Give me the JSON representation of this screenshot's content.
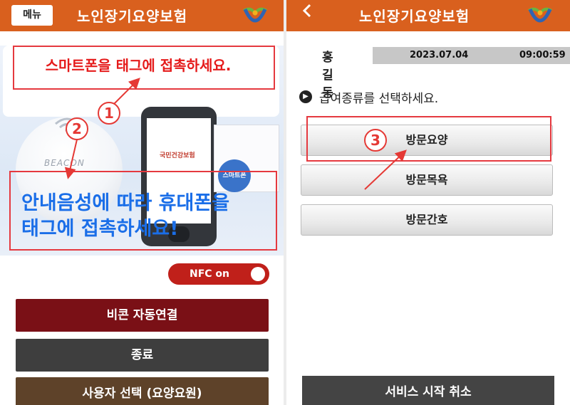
{
  "left_panel": {
    "header": {
      "menu_label": "메뉴",
      "title": "노인장기요양보험",
      "logo": "ltc-insurance-logo"
    },
    "instruction_top": "스마트폰을 태그에 접촉하세요.",
    "instruction_main_line1": "안내음성에 따라 휴대폰을",
    "instruction_main_line2": "태그에 접촉하세요!",
    "beacon_label": "BEACON",
    "phone_screen": {
      "brand": "국민건강보험",
      "circle_text": "스마트폰"
    },
    "badges": [
      "1",
      "2"
    ],
    "nfc_toggle": {
      "label": "NFC on",
      "state": "on"
    },
    "buttons": {
      "beacon_connect": "비콘 자동연결",
      "exit": "종료",
      "select_user": "사용자 선택 (요양요원)"
    }
  },
  "right_panel": {
    "header": {
      "back_icon": "chevron-left-icon",
      "title": "노인장기요양보험",
      "logo": "ltc-insurance-logo"
    },
    "user_name": "홍길동",
    "date": "2023.07.04",
    "time": "09:00:59",
    "prompt": "급여종류를 선택하세요.",
    "badge": "3",
    "services": [
      "방문요양",
      "방문목욕",
      "방문간호"
    ],
    "cancel_label": "서비스 시작 취소"
  },
  "colors": {
    "header": "#d9601e",
    "beacon_button": "#7a1016",
    "exit_button": "#3e3e3e",
    "select_user_button": "#5e4229",
    "cancel_button": "#444444",
    "highlight_red": "#e53935",
    "instruction_blue": "#1a6ee8"
  }
}
